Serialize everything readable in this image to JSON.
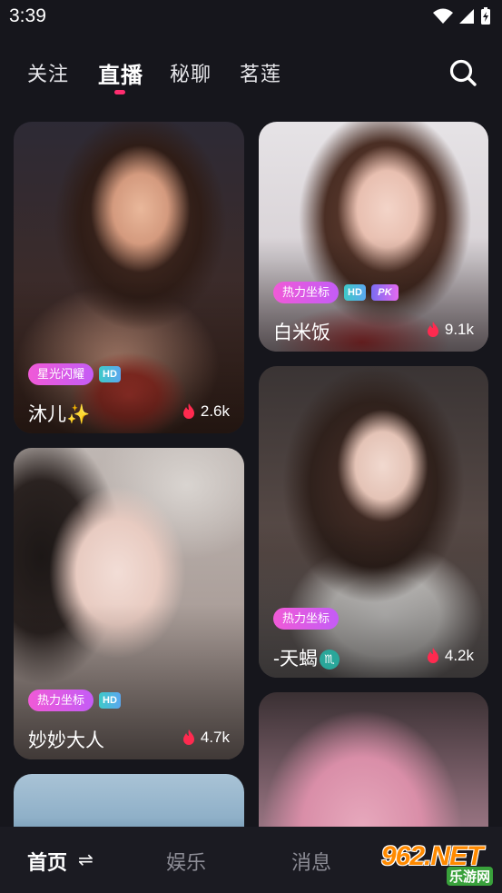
{
  "status": {
    "time": "3:39"
  },
  "top_tabs": [
    {
      "label": "关注",
      "active": false
    },
    {
      "label": "直播",
      "active": true
    },
    {
      "label": "秘聊",
      "active": false
    },
    {
      "label": "茗莲",
      "active": false
    }
  ],
  "accent_color": "#ff2d6f",
  "cards": [
    {
      "tag": "星光闪耀",
      "hd": "HD",
      "name": "沐儿✨",
      "heat": "2.6k"
    },
    {
      "tag": "热力坐标",
      "hd": "HD",
      "pk": "PK",
      "name": "白米饭",
      "heat": "9.1k"
    },
    {
      "tag": "热力坐标",
      "name": "-天蝎",
      "zodiac": "♏",
      "heat": "4.2k"
    },
    {
      "tag": "热力坐标",
      "hd": "HD",
      "name": "妙妙大人",
      "heat": "4.7k"
    }
  ],
  "bottom_nav": [
    {
      "label": "首页",
      "active": true,
      "switch": "⇌"
    },
    {
      "label": "娱乐",
      "active": false
    },
    {
      "label": "消息",
      "active": false
    }
  ],
  "watermark": {
    "big": "962.NET",
    "small": "乐游网"
  },
  "icons": [
    "wifi-icon",
    "signal-icon",
    "battery-charging-icon",
    "search-icon",
    "flame-icon",
    "scorpio-icon"
  ]
}
